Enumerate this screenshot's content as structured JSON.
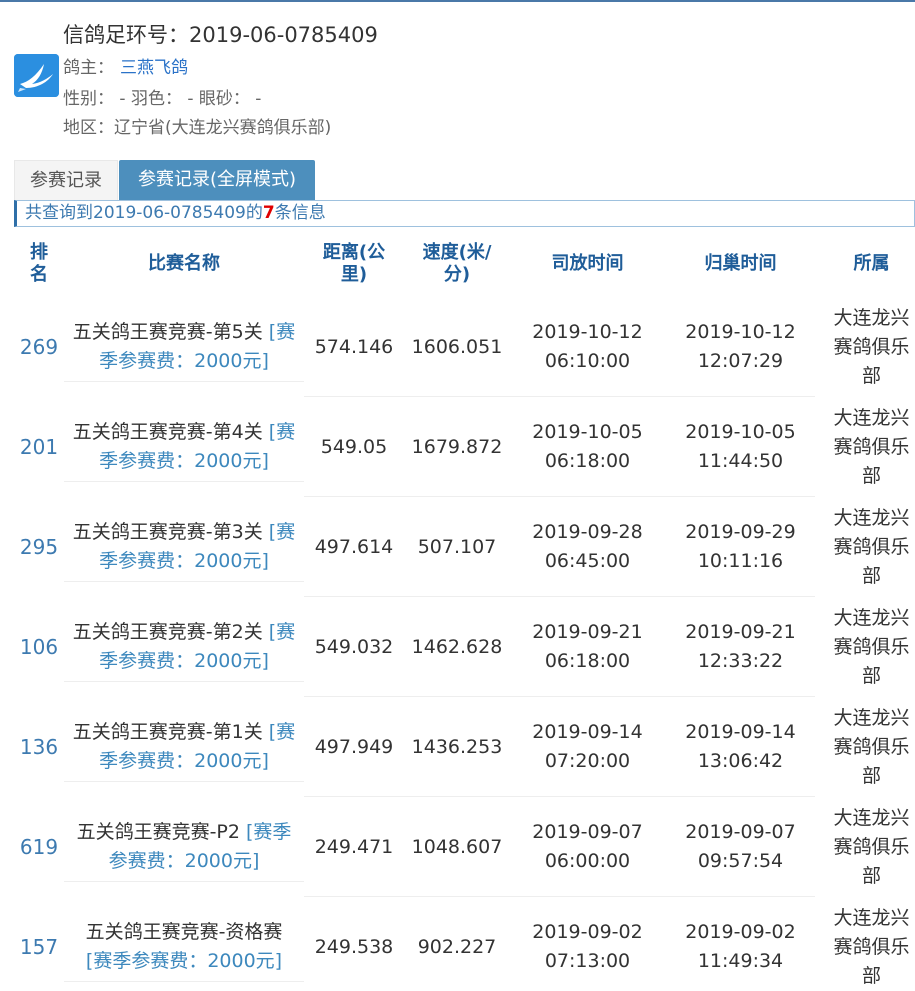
{
  "header": {
    "ring_label": "信鸽足环号：",
    "ring_number": "2019-06-0785409",
    "owner_label": "鸽主：",
    "owner_name": "三燕飞鸽",
    "sex_line": "性别：  - 羽色：  - 眼砂：  -",
    "region_label": "地区：",
    "region_value": "辽宁省(大连龙兴赛鸽俱乐部)"
  },
  "tabs": [
    {
      "label": "参赛记录",
      "active": false
    },
    {
      "label": "参赛记录(全屏模式)",
      "active": true
    }
  ],
  "summary": {
    "prefix": "共查询到2019-06-0785409的",
    "count": "7",
    "suffix": "条信息"
  },
  "columns": [
    "排名",
    "比赛名称",
    "距离(公里)",
    "速度(米/分)",
    "司放时间",
    "归巢时间",
    "所属"
  ],
  "rows": [
    {
      "rank": "269",
      "race": "五关鸽王赛竞赛-第5关",
      "fee": "[赛季参赛费：2000元]",
      "distance": "574.146",
      "speed": "1606.051",
      "release_date": "2019-10-12",
      "release_time": "06:10:00",
      "return_date": "2019-10-12",
      "return_time": "12:07:29",
      "club": "大连龙兴赛鸽俱乐部"
    },
    {
      "rank": "201",
      "race": "五关鸽王赛竞赛-第4关",
      "fee": "[赛季参赛费：2000元]",
      "distance": "549.05",
      "speed": "1679.872",
      "release_date": "2019-10-05",
      "release_time": "06:18:00",
      "return_date": "2019-10-05",
      "return_time": "11:44:50",
      "club": "大连龙兴赛鸽俱乐部"
    },
    {
      "rank": "295",
      "race": "五关鸽王赛竞赛-第3关",
      "fee": "[赛季参赛费：2000元]",
      "distance": "497.614",
      "speed": "507.107",
      "release_date": "2019-09-28",
      "release_time": "06:45:00",
      "return_date": "2019-09-29",
      "return_time": "10:11:16",
      "club": "大连龙兴赛鸽俱乐部"
    },
    {
      "rank": "106",
      "race": "五关鸽王赛竞赛-第2关",
      "fee": "[赛季参赛费：2000元]",
      "distance": "549.032",
      "speed": "1462.628",
      "release_date": "2019-09-21",
      "release_time": "06:18:00",
      "return_date": "2019-09-21",
      "return_time": "12:33:22",
      "club": "大连龙兴赛鸽俱乐部"
    },
    {
      "rank": "136",
      "race": "五关鸽王赛竞赛-第1关",
      "fee": "[赛季参赛费：2000元]",
      "distance": "497.949",
      "speed": "1436.253",
      "release_date": "2019-09-14",
      "release_time": "07:20:00",
      "return_date": "2019-09-14",
      "return_time": "13:06:42",
      "club": "大连龙兴赛鸽俱乐部"
    },
    {
      "rank": "619",
      "race": "五关鸽王赛竞赛-P2",
      "fee": "[赛季参赛费：2000元]",
      "distance": "249.471",
      "speed": "1048.607",
      "release_date": "2019-09-07",
      "release_time": "06:00:00",
      "return_date": "2019-09-07",
      "return_time": "09:57:54",
      "club": "大连龙兴赛鸽俱乐部"
    },
    {
      "rank": "157",
      "race": "五关鸽王赛竞赛-资格赛",
      "fee": "[赛季参赛费：2000元]",
      "distance": "249.538",
      "speed": "902.227",
      "release_date": "2019-09-02",
      "release_time": "07:13:00",
      "return_date": "2019-09-02",
      "return_time": "11:49:34",
      "club": "大连龙兴赛鸽俱乐部"
    }
  ]
}
